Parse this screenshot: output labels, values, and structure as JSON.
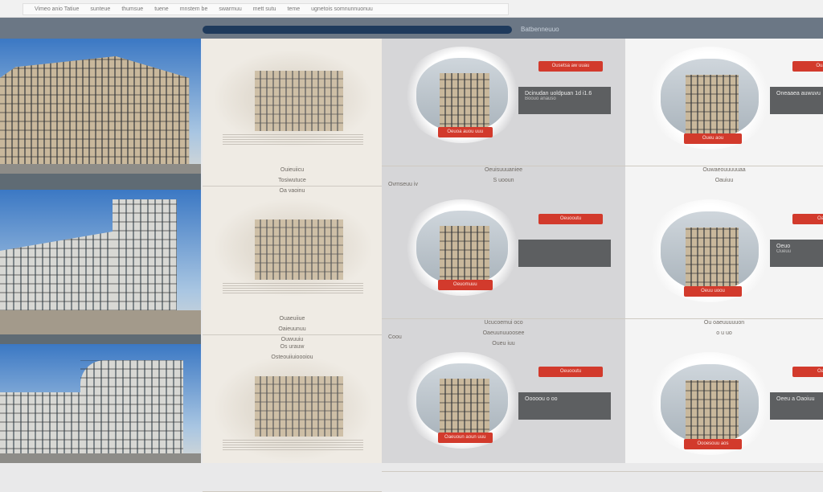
{
  "topbar": {
    "items": [
      "Vimeo anio Tatiue",
      "sunteue",
      "thumsue",
      "tuene",
      "mnstem be",
      "swarmuu",
      "mett sutu",
      "teme",
      "ugnetois somnunnuonuu"
    ]
  },
  "navbar": {
    "progress": 1.0,
    "label": "Batbenneuuo"
  },
  "columns": {
    "beige": {
      "captions": [
        [
          "Ouieuiicu",
          "Tosiwutuce",
          "Oa vaoinu"
        ],
        [
          "Ouaeuiiue",
          "Oaieuunuu",
          "Ouwuuiu"
        ],
        [
          "Os urauw",
          "Osteouiiuioooiou"
        ]
      ]
    },
    "grey": {
      "cards": [
        {
          "tag": "Ousetsa aw uuau",
          "banner": "Dcinudan uoldpuan  1d i1.6",
          "banner_sub": "Boouo anauso",
          "label": "Oeuoa auou uuu",
          "caption": "Oeuisuuuaniee",
          "caption2": "S uooun",
          "side": "Ovmseuu iv"
        },
        {
          "tag": "Oeuooutu",
          "banner": "",
          "label": "Oeuomuuu",
          "caption": "Ucucoemui oco",
          "caption2": "Oaeuunuuoosee",
          "caption3": "Oueu iuu",
          "side": "Coou"
        },
        {
          "tag": "Oeuooutu",
          "banner": "Ooooou o oo",
          "label": "Oaeuoun aoun uuu"
        }
      ]
    },
    "white": {
      "cards": [
        {
          "tag": "Ouaeuu",
          "banner": "Oneaaea auwuvu",
          "label": "Oueu aou",
          "caption": "Ouwaeouuuuuaa",
          "caption2": "Oauiuu"
        },
        {
          "tag": "Oaeuu",
          "banner": "Oeuo",
          "banner_sub": "Oueuu",
          "label": "Oeuu uoou",
          "caption": "Ou oaeuuuuuon",
          "caption2": "o u uo"
        },
        {
          "tag": "Oaeuu",
          "banner": "Oeeu a Oaoiuu",
          "label": "Oooesouu aos"
        }
      ]
    }
  },
  "colors": {
    "accent": "#d23a2c",
    "navbar": "#6b7785",
    "progress": "#1e3a5c",
    "banner": "#5d5f61"
  }
}
